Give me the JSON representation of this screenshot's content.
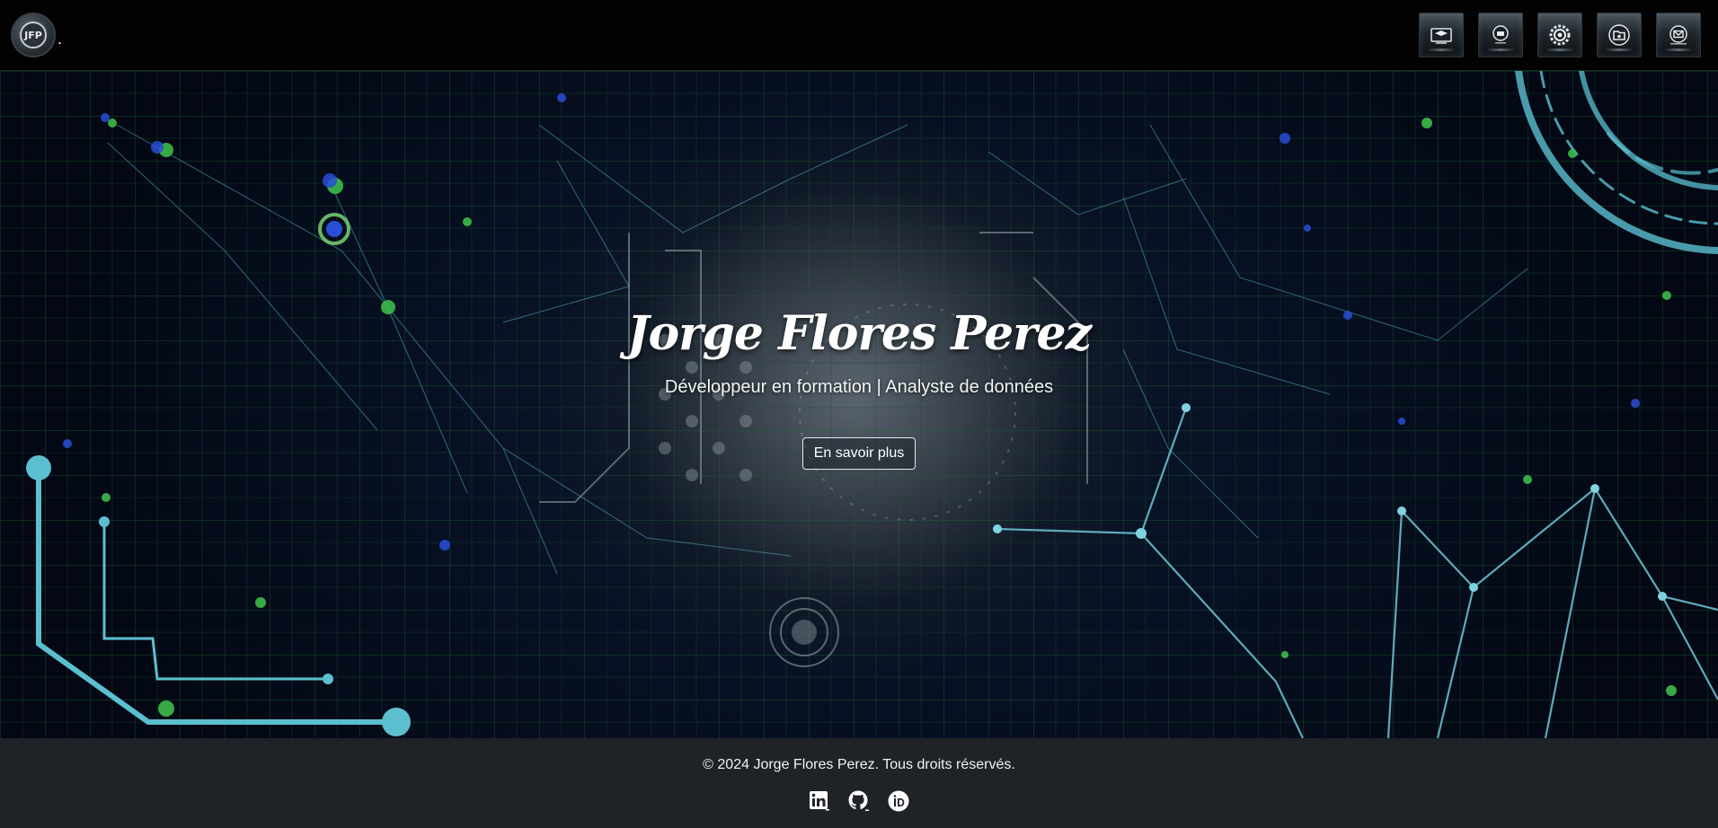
{
  "navbar": {
    "logo_text": "JFP",
    "brand_suffix": ".",
    "icons": [
      {
        "name": "education-icon"
      },
      {
        "name": "experience-icon"
      },
      {
        "name": "skills-icon"
      },
      {
        "name": "projects-icon"
      },
      {
        "name": "contact-icon"
      }
    ]
  },
  "hero": {
    "title": "Jorge Flores Perez",
    "subtitle": "Développeur en formation | Analyste de données",
    "button_label": "En savoir plus"
  },
  "footer": {
    "copyright": "© 2024 Jorge Flores Perez. Tous droits réservés.",
    "socials": [
      {
        "name": "linkedin-icon"
      },
      {
        "name": "github-icon"
      },
      {
        "name": "orcid-icon"
      }
    ]
  },
  "colors": {
    "accent_cyan": "#5bbfd0",
    "grid_green": "#2f8f3a",
    "footer_bg": "#1f2226",
    "navbar_bg": "#020202"
  }
}
